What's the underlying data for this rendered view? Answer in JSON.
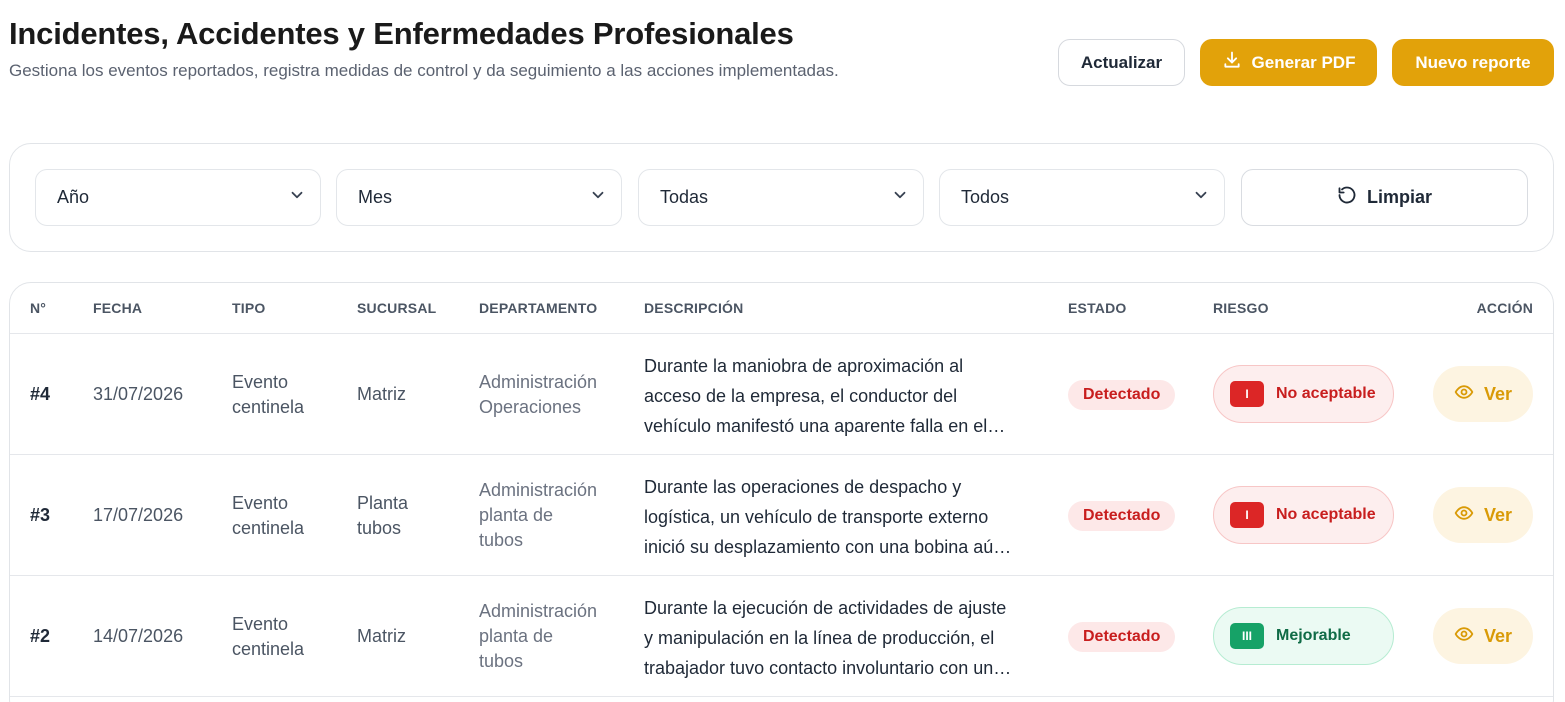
{
  "header": {
    "title": "Incidentes, Accidentes y Enfermedades Profesionales",
    "subtitle": "Gestiona los eventos reportados, registra medidas de control y da seguimiento a las acciones implementadas."
  },
  "toolbar": {
    "refresh_label": "Actualizar",
    "pdf_label": "Generar PDF",
    "new_label": "Nuevo reporte"
  },
  "filters": {
    "year": "Año",
    "month": "Mes",
    "branch": "Todas",
    "status": "Todos",
    "clear_label": "Limpiar"
  },
  "table": {
    "headers": [
      "N°",
      "FECHA",
      "TIPO",
      "SUCURSAL",
      "DEPARTAMENTO",
      "DESCRIPCIÓN",
      "ESTADO",
      "RIESGO",
      "ACCIÓN"
    ],
    "rows": [
      {
        "num": "#4",
        "date": "31/07/2026",
        "type": [
          "Evento",
          "centinela"
        ],
        "branch": [
          "Matriz"
        ],
        "dept": [
          "Administración",
          "Operaciones"
        ],
        "desc": [
          "Durante la maniobra de aproximación al",
          "acceso de la empresa, el conductor del",
          "vehículo manifestó una aparente falla en el…"
        ],
        "status": "Detectado",
        "risk_level": "I",
        "risk_label": "No aceptable",
        "action": "Ver"
      },
      {
        "num": "#3",
        "date": "17/07/2026",
        "type": [
          "Evento",
          "centinela"
        ],
        "branch": [
          "Planta",
          "tubos"
        ],
        "dept": [
          "Administración",
          "planta de",
          "tubos"
        ],
        "desc": [
          "Durante las operaciones de despacho y",
          "logística, un vehículo de transporte externo",
          "inició su desplazamiento con una bobina aú…"
        ],
        "status": "Detectado",
        "risk_level": "I",
        "risk_label": "No aceptable",
        "action": "Ver"
      },
      {
        "num": "#2",
        "date": "14/07/2026",
        "type": [
          "Evento",
          "centinela"
        ],
        "branch": [
          "Matriz"
        ],
        "dept": [
          "Administración",
          "planta de",
          "tubos"
        ],
        "desc": [
          "Durante la ejecución de actividades de ajuste",
          "y manipulación en la línea de producción, el",
          "trabajador tuvo contacto involuntario con un…"
        ],
        "status": "Detectado",
        "risk_level": "III",
        "risk_label": "Mejorable",
        "action": "Ver"
      }
    ]
  },
  "colors": {
    "accent": "#e2a20a",
    "status_red": "#c81e1e",
    "risk_green": "#16a267"
  }
}
